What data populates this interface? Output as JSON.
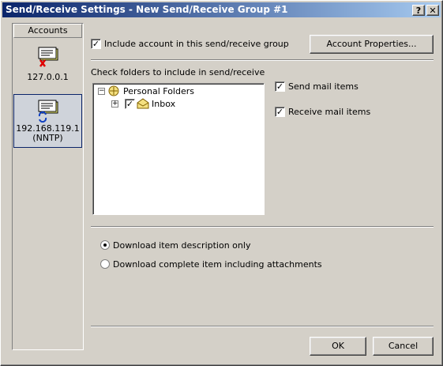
{
  "window": {
    "title": "Send/Receive Settings - New Send/Receive Group #1",
    "help_label": "?",
    "close_label": "✕"
  },
  "sidebar": {
    "header": "Accounts",
    "accounts": [
      {
        "label": "127.0.0.1",
        "icon": "account-disabled-icon",
        "selected": false
      },
      {
        "label": "192.168.119.1\n(NNTP)",
        "line1": "192.168.119.1",
        "line2": "(NNTP)",
        "icon": "account-sync-icon",
        "selected": true
      }
    ]
  },
  "include_account": {
    "label": "Include account in this send/receive group",
    "checked": true
  },
  "account_properties_button": "Account Properties...",
  "folders": {
    "heading": "Check folders to include in send/receive",
    "tree": [
      {
        "label": "Personal Folders",
        "expander": "−"
      },
      {
        "label": "Inbox",
        "expander": "+",
        "checked": true
      }
    ]
  },
  "options": {
    "send_mail": {
      "label": "Send mail items",
      "checked": true
    },
    "receive_mail": {
      "label": "Receive mail items",
      "checked": true
    }
  },
  "download": {
    "option1": {
      "label": "Download item description only",
      "selected": true
    },
    "option2": {
      "label": "Download complete item including attachments",
      "selected": false
    }
  },
  "footer": {
    "ok": "OK",
    "cancel": "Cancel"
  },
  "colors": {
    "titlebar_start": "#0a246a",
    "titlebar_end": "#a6caf0",
    "face": "#d4d0c8"
  }
}
